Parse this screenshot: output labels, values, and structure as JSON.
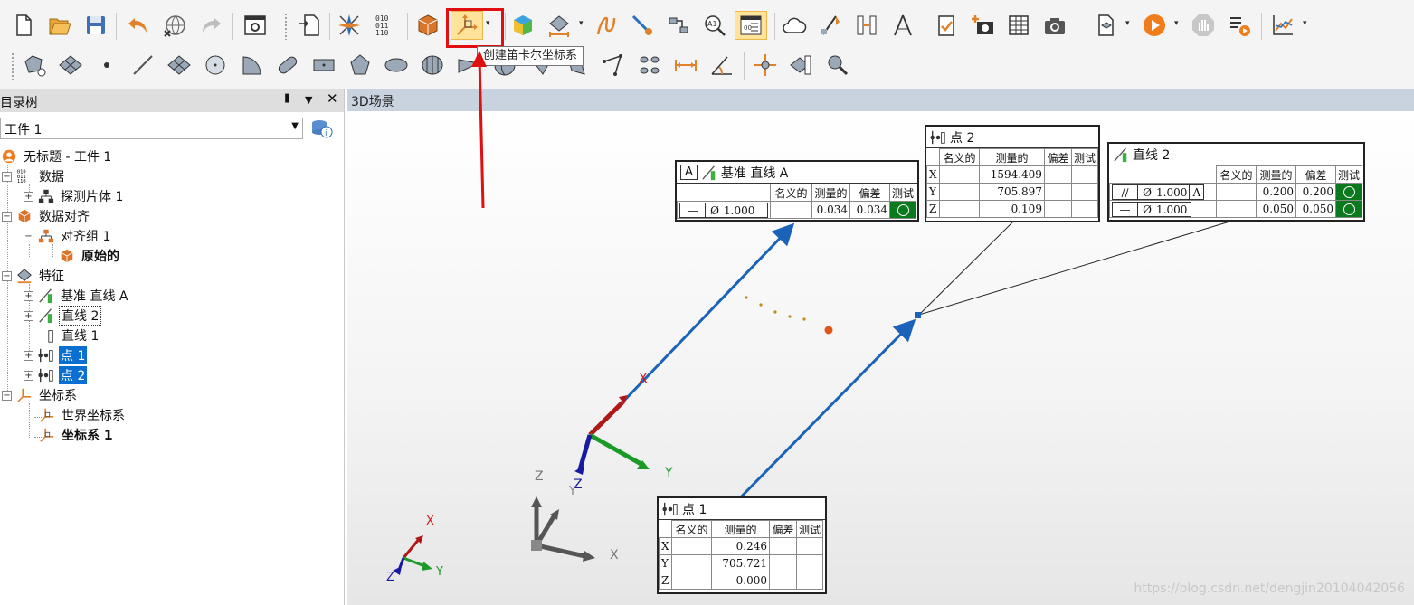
{
  "tooltip": "创建笛卡尔坐标系",
  "left_panel": {
    "title": "目录树",
    "combo_value": "工件 1",
    "tree": {
      "root": "无标题 - 工件 1",
      "data": "数据",
      "probe_piece": "探测片体 1",
      "alignment": "数据对齐",
      "align_group": "对齐组 1",
      "original": "原始的",
      "features": "特征",
      "datum_line_a": "基准 直线 A",
      "line2": "直线 2",
      "line1": "直线 1",
      "point1": "点 1",
      "point2": "点 2",
      "coord_systems": "坐标系",
      "world_cs": "世界坐标系",
      "cs1": "坐标系 1"
    }
  },
  "scene": {
    "title": "3D场景",
    "axis_labels": {
      "x": "X",
      "y": "Y",
      "z": "Z"
    },
    "watermark": "https://blog.csdn.net/dengjin20104042056"
  },
  "boxes": {
    "col_nominal": "名义的",
    "col_measured": "测量的",
    "col_dev": "偏差",
    "col_test": "测试",
    "datum": {
      "letter": "A",
      "title": "基准 直线 A",
      "symbol": "Ø",
      "tol": "1.000",
      "measured": "0.034",
      "dev": "0.034"
    },
    "point2": {
      "title": "点 2",
      "rows": [
        {
          "axis": "X",
          "measured": "1594.409"
        },
        {
          "axis": "Y",
          "measured": "705.897"
        },
        {
          "axis": "Z",
          "measured": "0.109"
        }
      ]
    },
    "line2": {
      "title": "直线 2",
      "r1_sym": "Ø",
      "r1_tol": "1.000",
      "r1_ref": "A",
      "r1_measured": "0.200",
      "r1_dev": "0.200",
      "r2_sym": "Ø",
      "r2_tol": "1.000",
      "r2_measured": "0.050",
      "r2_dev": "0.050"
    },
    "point1": {
      "title": "点 1",
      "rows": [
        {
          "axis": "X",
          "measured": "0.246"
        },
        {
          "axis": "Y",
          "measured": "705.721"
        },
        {
          "axis": "Z",
          "measured": "0.000"
        }
      ]
    }
  }
}
